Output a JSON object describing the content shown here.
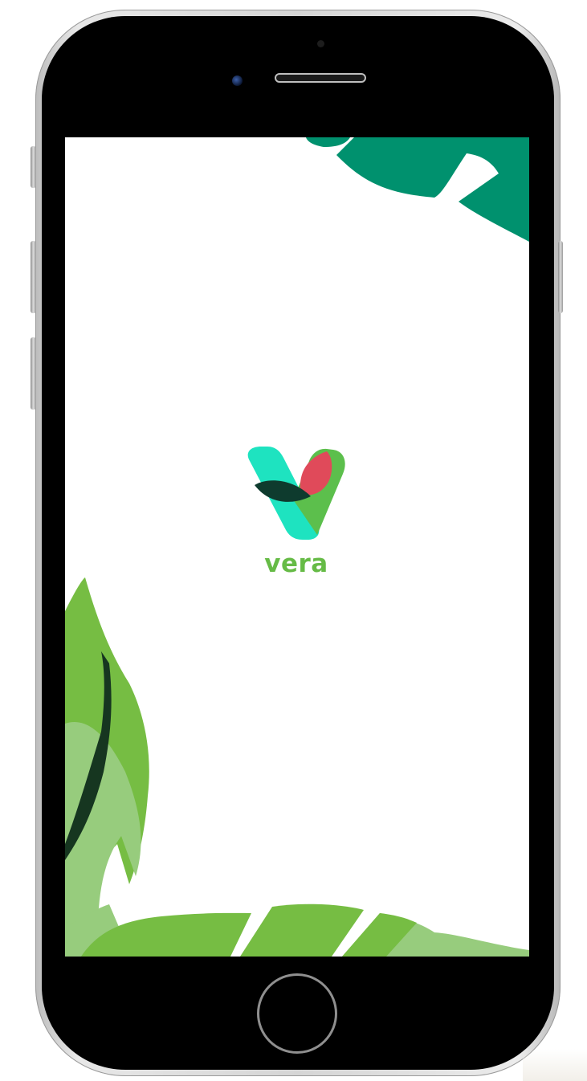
{
  "app": {
    "brand_name": "vera"
  },
  "colors": {
    "logo_teal": "#1ee3c0",
    "logo_dark_leaf": "#0e3b2e",
    "logo_red_petal": "#e04a5a",
    "logo_green": "#5cbf4c",
    "brand_text": "#66bb46",
    "leaf_top_dark_green": "#00916e",
    "leaf_bottom_green": "#76bd43",
    "leaf_bottom_light": "#97cc7d"
  },
  "icons": {
    "logo": "vera-v-leaf-logo",
    "top_decoration": "tropical-leaf-top-right",
    "bottom_decoration": "tropical-leaf-bottom-left",
    "home_button": "home-button-ring"
  }
}
